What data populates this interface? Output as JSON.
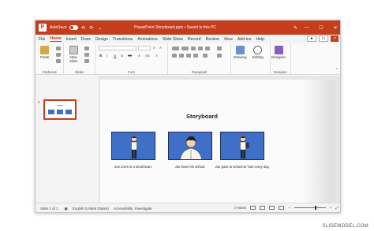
{
  "titlebar": {
    "autosave_label": "AutoSave",
    "toggle_state": "Off",
    "document_title": "PowerPoint Storyboard.pptx • Saved to this PC",
    "minimize": "—",
    "maximize": "☐",
    "close": "✕"
  },
  "menu": {
    "tabs": [
      "File",
      "Home",
      "Insert",
      "Draw",
      "Design",
      "Transitions",
      "Animations",
      "Slide Show",
      "Record",
      "Review",
      "View",
      "Add-ins",
      "Help"
    ],
    "active_tab": "Home"
  },
  "ribbon": {
    "groups": {
      "clipboard": "Clipboard",
      "slides": "Slides",
      "font": "Font",
      "paragraph": "Paragraph",
      "designer": "Designer"
    },
    "buttons": {
      "paste": "Paste",
      "new_slide": "New Slide",
      "drawing": "Drawing",
      "editing": "Editing",
      "designer": "Designer"
    },
    "font_buttons": [
      "B",
      "I",
      "U",
      "S",
      "ab",
      "A",
      "Aa",
      "A"
    ]
  },
  "thumbnails": {
    "slide_number": "1"
  },
  "slide": {
    "title": "Storyboard",
    "panel_color": "#3f6fc6",
    "captions": [
      "Joe Lives in a small town.",
      "Joe loves his school.",
      "Joe goes to school at 7am every day."
    ]
  },
  "status": {
    "slide_info": "Slide 1 of 1",
    "language": "English (United States)",
    "accessibility": "Accessibility: Investigate",
    "notes": "Notes"
  },
  "watermark": "SLIDEMODEL.COM",
  "colors": {
    "accent": "#c43e1c",
    "panel": "#3f6fc6"
  }
}
